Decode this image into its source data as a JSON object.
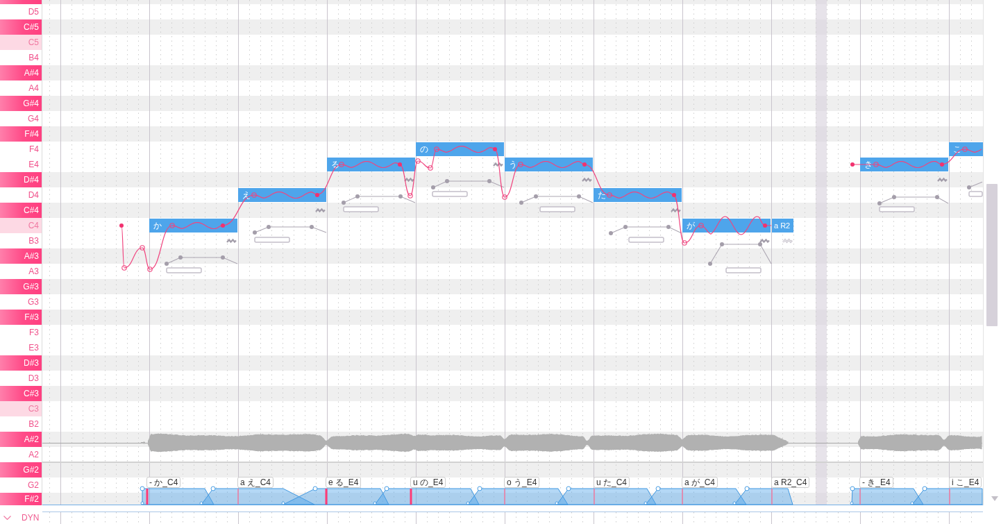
{
  "piano_keys": [
    {
      "kind": "black"
    },
    {
      "label": "D5",
      "kind": "white"
    },
    {
      "label": "C#5",
      "kind": "black"
    },
    {
      "label": "C5",
      "kind": "octave"
    },
    {
      "label": "B4",
      "kind": "white"
    },
    {
      "label": "A#4",
      "kind": "black"
    },
    {
      "label": "A4",
      "kind": "white"
    },
    {
      "label": "G#4",
      "kind": "black"
    },
    {
      "label": "G4",
      "kind": "white"
    },
    {
      "label": "F#4",
      "kind": "black"
    },
    {
      "label": "F4",
      "kind": "white"
    },
    {
      "label": "E4",
      "kind": "white"
    },
    {
      "label": "D#4",
      "kind": "black"
    },
    {
      "label": "D4",
      "kind": "white"
    },
    {
      "label": "C#4",
      "kind": "black"
    },
    {
      "label": "C4",
      "kind": "octave"
    },
    {
      "label": "B3",
      "kind": "white"
    },
    {
      "label": "A#3",
      "kind": "black"
    },
    {
      "label": "A3",
      "kind": "white"
    },
    {
      "label": "G#3",
      "kind": "black"
    },
    {
      "label": "G3",
      "kind": "white"
    },
    {
      "label": "F#3",
      "kind": "black"
    },
    {
      "label": "F3",
      "kind": "white"
    },
    {
      "label": "E3",
      "kind": "white"
    },
    {
      "label": "D#3",
      "kind": "black"
    },
    {
      "label": "D3",
      "kind": "white"
    },
    {
      "label": "C#3",
      "kind": "black"
    },
    {
      "label": "C3",
      "kind": "octave"
    },
    {
      "label": "B2",
      "kind": "white"
    },
    {
      "label": "A#2",
      "kind": "black"
    },
    {
      "label": "A2",
      "kind": "white"
    },
    {
      "label": "G#2",
      "kind": "black"
    },
    {
      "label": "G2",
      "kind": "white"
    },
    {
      "label": "F#2",
      "kind": "black"
    }
  ],
  "notes": [
    {
      "lyric": "か",
      "vibrato": true
    },
    {
      "lyric": "え",
      "vibrato": true
    },
    {
      "lyric": "る",
      "vibrato": true
    },
    {
      "lyric": "の",
      "vibrato": true
    },
    {
      "lyric": "う",
      "vibrato": true
    },
    {
      "lyric": "た",
      "vibrato": true
    },
    {
      "lyric": "が",
      "vibrato": true
    },
    {
      "lyric": "a R2",
      "vibrato": false
    },
    {
      "lyric": "き",
      "vibrato": true
    },
    {
      "lyric": "こ",
      "vibrato": true
    }
  ],
  "phonemes": [
    {
      "label": "- か_C4"
    },
    {
      "label": "a え_C4"
    },
    {
      "label": "e る_E4"
    },
    {
      "label": "u の_E4"
    },
    {
      "label": "o う_E4"
    },
    {
      "label": "u た_C4"
    },
    {
      "label": "a が_C4"
    },
    {
      "label": "a R2_C4"
    },
    {
      "label": "- き_E4"
    },
    {
      "label": "i こ_E4"
    }
  ],
  "expression_lane": {
    "label": "DYN"
  }
}
